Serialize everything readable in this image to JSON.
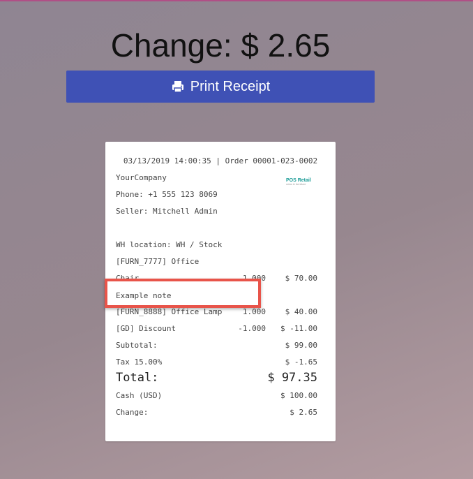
{
  "header": {
    "change_text": "Change: $ 2.65",
    "print_button_label": "Print Receipt"
  },
  "receipt": {
    "date_order": "03/13/2019 14:00:35 | Order 00001-023-0002",
    "company": "YourCompany",
    "phone": "Phone: +1 555 123 8069",
    "seller": "Seller: Mitchell Admin",
    "logo_title": "POS Retail",
    "logo_sub": "odoo & furniture",
    "wh_location": "WH location: WH / Stock",
    "lines": [
      {
        "name": "[FURN_7777] Office",
        "qty": "",
        "amount": ""
      },
      {
        "name": "Chair",
        "qty": "1.000",
        "amount": "$ 70.00"
      },
      {
        "name": "[FURN_8888] Office Lamp",
        "qty": "1.000",
        "amount": "$ 40.00"
      },
      {
        "name": "[GD] Discount",
        "qty": "-1.000",
        "amount": "$ -11.00"
      }
    ],
    "subtotal_label": "Subtotal:",
    "subtotal": "$ 99.00",
    "tax_label": "Tax 15.00%",
    "tax": "$ -1.65",
    "total_label": "Total:",
    "total": "$ 97.35",
    "cash_label": "Cash (USD)",
    "cash": "$ 100.00",
    "change_label": "Change:",
    "change": "$ 2.65"
  },
  "note": {
    "text": "Example note"
  }
}
